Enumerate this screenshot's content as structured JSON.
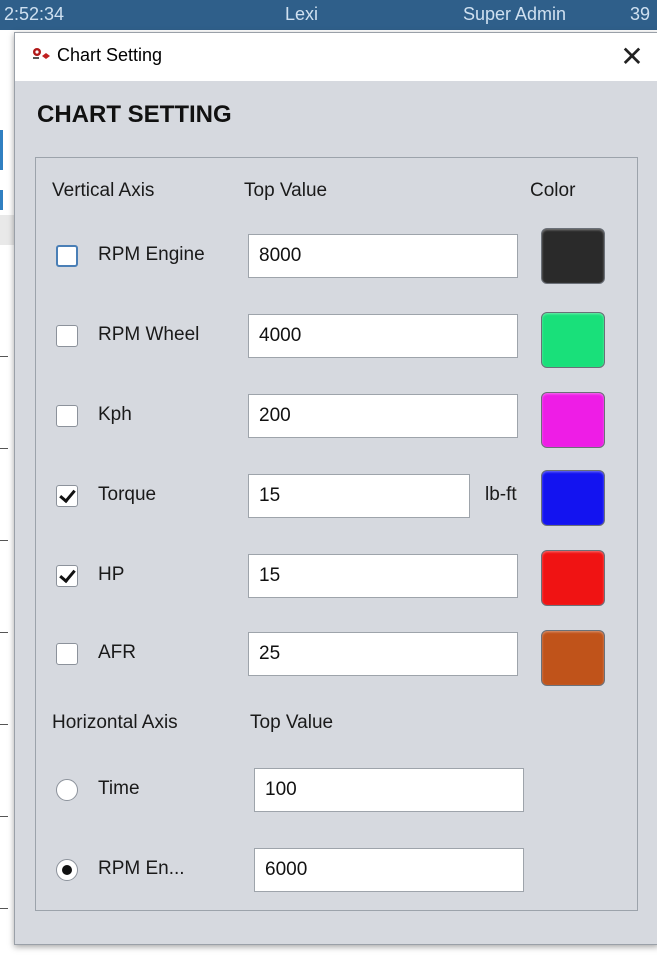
{
  "background": {
    "time": "2:52:34",
    "user": "Lexi",
    "role": "Super Admin",
    "extra": "39"
  },
  "window": {
    "title": "Chart Setting",
    "close_label": "✕"
  },
  "heading": "CHART SETTING",
  "vertical": {
    "header_axis": "Vertical Axis",
    "header_top": "Top Value",
    "header_color": "Color",
    "rows": [
      {
        "label": "RPM Engine",
        "checked": false,
        "value": "8000",
        "unit": "",
        "color": "#2a2a2a"
      },
      {
        "label": "RPM Wheel",
        "checked": false,
        "value": "4000",
        "unit": "",
        "color": "#19e07a"
      },
      {
        "label": "Kph",
        "checked": false,
        "value": "200",
        "unit": "",
        "color": "#ee1de6"
      },
      {
        "label": "Torque",
        "checked": true,
        "value": "15",
        "unit": "lb-ft",
        "color": "#1313f0"
      },
      {
        "label": "HP",
        "checked": true,
        "value": "15",
        "unit": "",
        "color": "#f01313"
      },
      {
        "label": "AFR",
        "checked": false,
        "value": "25",
        "unit": "",
        "color": "#c0531a"
      }
    ]
  },
  "horizontal": {
    "header_axis": "Horizontal Axis",
    "header_top": "Top Value",
    "options": [
      {
        "label": "Time",
        "selected": false,
        "value": "100"
      },
      {
        "label": "RPM En...",
        "selected": true,
        "value": "6000"
      }
    ]
  }
}
